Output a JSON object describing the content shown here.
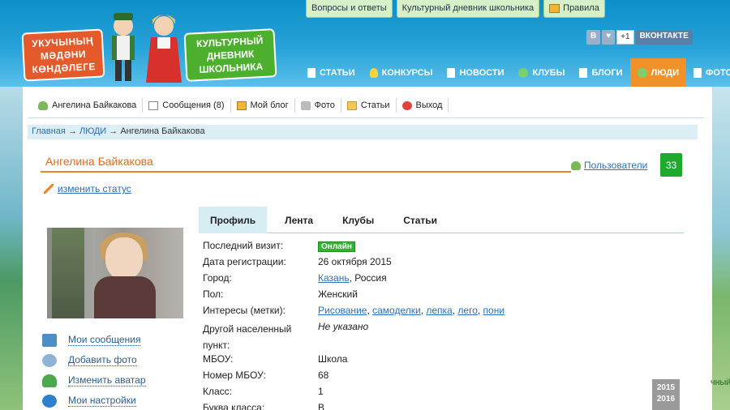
{
  "header": {
    "top_links": [
      {
        "label": "Вопросы и ответы"
      },
      {
        "label": "Культурный дневник школьника"
      },
      {
        "label": "Правила"
      }
    ],
    "logo_left_lines": [
      "УКУЧЫНЫҢ",
      "МӘДӘНИ",
      "КӨНДӘЛЕГЕ"
    ],
    "logo_right_lines": [
      "КУЛЬТУРНЫЙ",
      "ДНЕВНИК",
      "ШКОЛЬНИКА"
    ],
    "social": {
      "vk_short": "В",
      "heart": "♥",
      "count": "+1",
      "vk_label": "ВКОНТАКТЕ"
    },
    "nav": [
      {
        "label": "СТАТЬИ"
      },
      {
        "label": "КОНКУРСЫ"
      },
      {
        "label": "НОВОСТИ"
      },
      {
        "label": "КЛУБЫ"
      },
      {
        "label": "БЛОГИ"
      },
      {
        "label": "ЛЮДИ"
      },
      {
        "label": "ФОТО"
      }
    ]
  },
  "userbar": [
    {
      "label": "Ангелина Байкакова"
    },
    {
      "label": "Сообщения (8)"
    },
    {
      "label": "Мой блог"
    },
    {
      "label": "Фото"
    },
    {
      "label": "Статьи"
    },
    {
      "label": "Выход"
    }
  ],
  "breadcrumb": {
    "home": "Главная",
    "sep": "→",
    "section": "ЛЮДИ",
    "current": "Ангелина Байкакова"
  },
  "profile": {
    "name": "Ангелина Байкакова",
    "users_link": "Пользователи",
    "users_count": "33",
    "status_link": "изменить статус"
  },
  "side_menu": [
    {
      "label": "Мои сообщения"
    },
    {
      "label": "Добавить фото"
    },
    {
      "label": "Изменить аватар"
    },
    {
      "label": "Мои настройки"
    }
  ],
  "tabs": [
    {
      "label": "Профиль"
    },
    {
      "label": "Лента"
    },
    {
      "label": "Клубы"
    },
    {
      "label": "Статьи"
    }
  ],
  "info": {
    "last_visit_label": "Последний визит:",
    "last_visit_value": "Онлайн",
    "reg_label": "Дата регистрации:",
    "reg_value": "26 октября 2015",
    "city_label": "Город:",
    "city_link": "Казань",
    "city_rest": ", Россия",
    "gender_label": "Пол:",
    "gender_value": "Женский",
    "interests_label": "Интересы (метки):",
    "interests": [
      "Рисование",
      "самоделки",
      "лепка",
      "лего",
      "пони"
    ],
    "other_place_label": "Другой населенный пункт:",
    "other_place_value": "Не указано",
    "school_label": "МБОУ:",
    "school_value": "Школа",
    "school_num_label": "Номер МБОУ:",
    "school_num_value": "68",
    "class_label": "Класс:",
    "class_value": "1",
    "class_letter_label": "Буква класса:",
    "class_letter_value": "В"
  },
  "year_badge": {
    "line1": "2015",
    "line2": "2016"
  },
  "right_side_label": "ЧНЫЙ"
}
